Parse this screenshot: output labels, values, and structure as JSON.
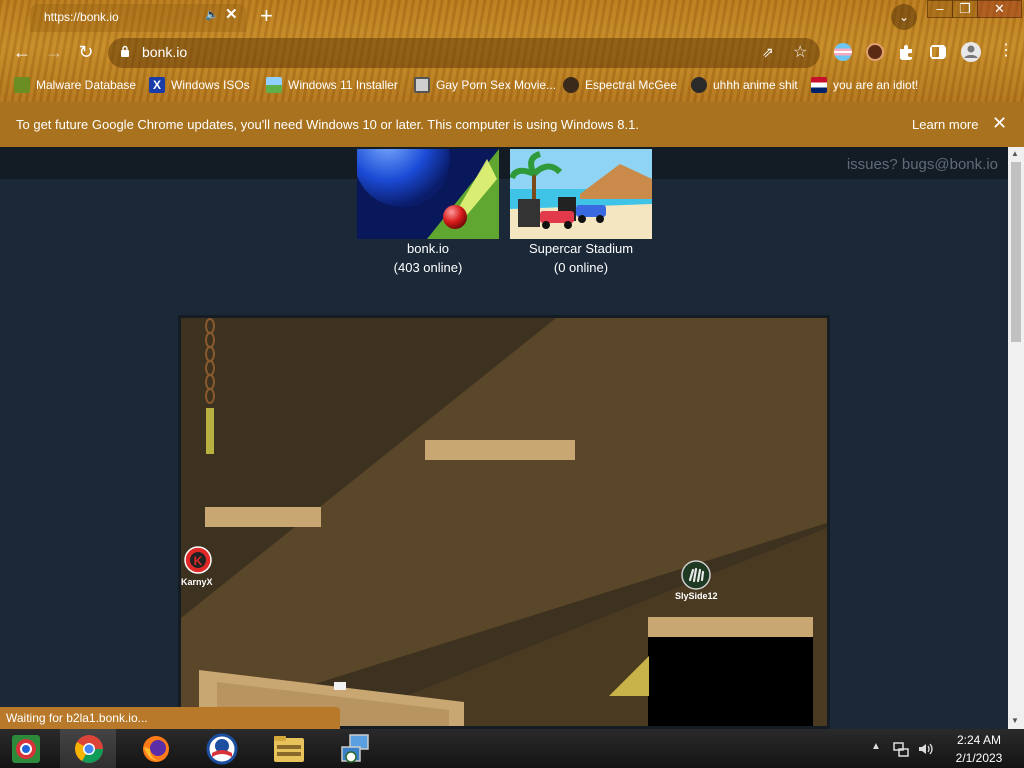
{
  "browser": {
    "tab_title": "https://bonk.io",
    "url": "bonk.io",
    "new_tab_symbol": "+",
    "tab_close_symbol": "✕"
  },
  "bookmarks": [
    {
      "label": "Malware Database",
      "icon": "bug-icon"
    },
    {
      "label": "Windows ISOs",
      "icon": "x-icon"
    },
    {
      "label": "Windows 11 Installer",
      "icon": "image-icon"
    },
    {
      "label": "Gay Porn Sex Movie...",
      "icon": "disk-icon"
    },
    {
      "label": "Espectral McGee",
      "icon": "face-icon"
    },
    {
      "label": "uhhh anime shit",
      "icon": "anime-icon"
    },
    {
      "label": "you are an idiot!",
      "icon": "flag-icon"
    }
  ],
  "infobar": {
    "message": "To get future Google Chrome updates, you'll need Windows 10 or later. This computer is using Windows 8.1.",
    "learn_more": "Learn more"
  },
  "page": {
    "bugs_text": "issues? bugs@bonk.io",
    "games": [
      {
        "name": "bonk.io",
        "online": "(403 online)"
      },
      {
        "name": "Supercar Stadium",
        "online": "(0 online)"
      }
    ],
    "players": [
      {
        "name": "KarnyX"
      },
      {
        "name": "SlySide12"
      }
    ]
  },
  "status": {
    "text": "Waiting for b2la1.bonk.io..."
  },
  "taskbar": {
    "time": "2:24 AM",
    "date": "2/1/2023"
  },
  "colors": {
    "page_bg": "#1b2838",
    "game_bg": "#3b2f1e",
    "platform": "#c9a772",
    "chrome_wood": "#b87a1c",
    "infobar": "#a8721e"
  }
}
